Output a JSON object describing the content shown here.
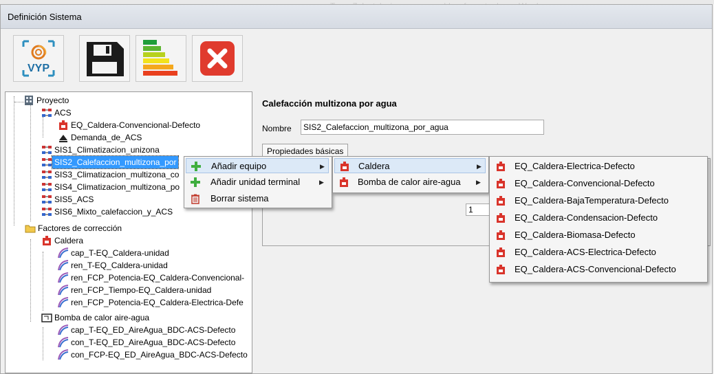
{
  "background_window_title": "Tema 7. Instalaciones y renovables_formato.docx - Word",
  "window_title": "Definición Sistema",
  "toolbar": {
    "logo_text": "VYP",
    "buttons": [
      {
        "name": "vyp-logo-button",
        "icon": "vyp-logo-icon"
      },
      {
        "name": "save-button",
        "icon": "floppy-disk-icon"
      },
      {
        "name": "energy-rating-button",
        "icon": "energy-label-icon"
      },
      {
        "name": "close-button",
        "icon": "red-x-icon"
      }
    ]
  },
  "tree": {
    "items": [
      {
        "label": "Proyecto",
        "icon": "project-icon"
      },
      {
        "label": "ACS",
        "icon": "system-icon"
      },
      {
        "label": "EQ_Caldera-Convencional-Defecto",
        "icon": "boiler-icon"
      },
      {
        "label": "Demanda_de_ACS",
        "icon": "shower-icon"
      },
      {
        "label": "SIS1_Climatizacion_unizona",
        "icon": "system-icon"
      },
      {
        "label": "SIS2_Calefaccion_multizona_por",
        "icon": "system-icon",
        "selected": true
      },
      {
        "label": "SIS3_Climatizacion_multizona_co",
        "icon": "system-icon"
      },
      {
        "label": "SIS4_Climatizacion_multizona_po",
        "icon": "system-icon"
      },
      {
        "label": "SIS5_ACS",
        "icon": "system-icon"
      },
      {
        "label": "SIS6_Mixto_calefaccion_y_ACS",
        "icon": "system-icon"
      },
      {
        "label": "Factores de corrección",
        "icon": "folder-icon"
      },
      {
        "label": "Caldera",
        "icon": "boiler-icon"
      },
      {
        "label": "cap_T-EQ_Caldera-unidad",
        "icon": "curve-icon"
      },
      {
        "label": "ren_T-EQ_Caldera-unidad",
        "icon": "curve-icon"
      },
      {
        "label": "ren_FCP_Potencia-EQ_Caldera-Convencional-",
        "icon": "curve-icon"
      },
      {
        "label": "ren_FCP_Tiempo-EQ_Caldera-unidad",
        "icon": "curve-icon"
      },
      {
        "label": "ren_FCP_Potencia-EQ_Caldera-Electrica-Defe",
        "icon": "curve-icon"
      },
      {
        "label": "Bomba de calor aire-agua",
        "icon": "heat-pump-icon"
      },
      {
        "label": "cap_T-EQ_ED_AireAgua_BDC-ACS-Defecto",
        "icon": "curve-icon"
      },
      {
        "label": "con_T-EQ_ED_AireAgua_BDC-ACS-Defecto",
        "icon": "curve-icon"
      },
      {
        "label": "con_FCP-EQ_ED_AireAgua_BDC-ACS-Defecto",
        "icon": "curve-icon"
      }
    ]
  },
  "panel": {
    "title": "Calefacción multizona por agua",
    "name_label": "Nombre",
    "name_value": "SIS2_Calefaccion_multizona_por_agua",
    "tab_label": "Propiedades básicas",
    "number_value": "1"
  },
  "context_menu": {
    "items": [
      {
        "label": "Añadir equipo",
        "icon": "green-plus-icon",
        "has_submenu": true,
        "highlighted": true
      },
      {
        "label": "Añadir unidad terminal",
        "icon": "green-plus-icon",
        "has_submenu": true
      },
      {
        "label": "Borrar sistema",
        "icon": "trash-icon"
      }
    ]
  },
  "equipment_submenu": {
    "items": [
      {
        "label": "Caldera",
        "icon": "boiler-icon",
        "has_submenu": true,
        "highlighted": true
      },
      {
        "label": "Bomba de calor aire-agua",
        "icon": "boiler-icon",
        "has_submenu": true
      }
    ]
  },
  "boiler_submenu": {
    "items": [
      {
        "label": "EQ_Caldera-Electrica-Defecto"
      },
      {
        "label": "EQ_Caldera-Convencional-Defecto"
      },
      {
        "label": "EQ_Caldera-BajaTemperatura-Defecto"
      },
      {
        "label": "EQ_Caldera-Condensacion-Defecto"
      },
      {
        "label": "EQ_Caldera-Biomasa-Defecto"
      },
      {
        "label": "EQ_Caldera-ACS-Electrica-Defecto"
      },
      {
        "label": "EQ_Caldera-ACS-Convencional-Defecto"
      }
    ]
  },
  "colors": {
    "selection": "#3399ff",
    "close_red": "#e03b2e",
    "plus_green": "#3fae3f",
    "boiler_red": "#d9342b"
  }
}
